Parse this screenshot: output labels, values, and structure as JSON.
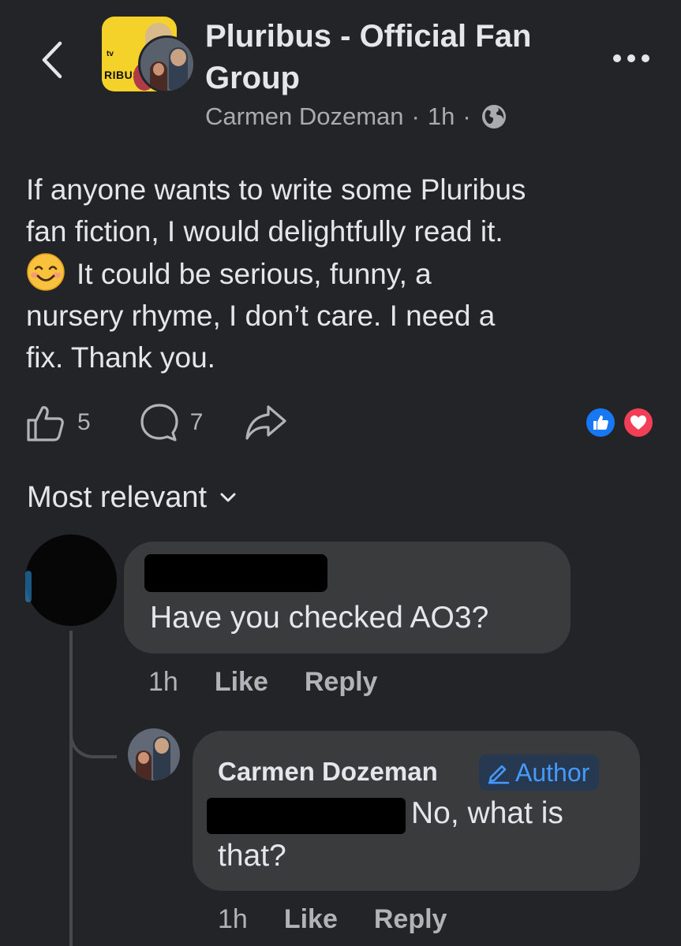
{
  "header": {
    "group_name": "Pluribus - Official Fan Group",
    "group_avatar_text": "tv",
    "group_avatar_wordmark": "RIBUS",
    "author": "Carmen Dozeman",
    "separator": "·",
    "time": "1h",
    "privacy_icon": "globe-icon"
  },
  "post": {
    "lines": [
      "If anyone wants to write some Pluribus",
      "fan fiction, I would delightfully read it.",
      "It could be serious, funny, a",
      "nursery rhyme, I don’t care. I need a",
      "fix. Thank you."
    ],
    "emoji": "smiling-face-emoji"
  },
  "actions": {
    "like_count": "5",
    "comment_count": "7",
    "share_icon": "share-icon",
    "reactions": [
      "like",
      "love"
    ]
  },
  "sort": {
    "label": "Most relevant"
  },
  "comments": [
    {
      "author_redacted": true,
      "text": "Have you checked AO3?",
      "time": "1h",
      "like_label": "Like",
      "reply_label": "Reply"
    },
    {
      "author": "Carmen Dozeman",
      "badge": "Author",
      "text_part1": "No, what is",
      "text_part2": "that?",
      "time": "1h",
      "like_label": "Like",
      "reply_label": "Reply"
    }
  ],
  "colors": {
    "background": "#232427",
    "bubble": "#3a3b3d",
    "text_primary": "#e4e6eb",
    "text_secondary": "#b0b3b8",
    "accent_blue": "#1877f2",
    "love_red": "#f33e58",
    "author_badge_bg": "#263951",
    "author_badge_text": "#4599ff"
  }
}
